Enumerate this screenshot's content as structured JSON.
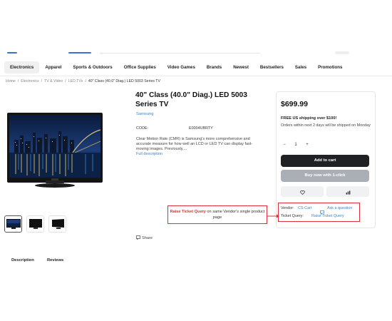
{
  "nav": {
    "categories": [
      "Electronics",
      "Apparel",
      "Sports & Outdoors",
      "Office Supplies",
      "Video Games",
      "Brands",
      "Newest",
      "Bestsellers",
      "Sales",
      "Promotions"
    ]
  },
  "breadcrumb": {
    "items": [
      "Home",
      "Electronics",
      "TV & Video",
      "LED TVs"
    ],
    "current": "40\" Class (40.0\" Diag.) LED 5003 Series TV",
    "separator": "/"
  },
  "product": {
    "title": "40\" Class (40.0\" Diag.) LED 5003 Series TV",
    "brand": "Samsung",
    "code_label": "CODE:",
    "code_value": "E0004UBRTY",
    "description": "Clear Motion Rate (CMR) is Samsung's more comprehensive and accurate measure for how well an LCD or LED TV can display fast-moving images. Previously,...",
    "full_description_link": "Full description",
    "share_label": "Share"
  },
  "buybox": {
    "price": "$699.99",
    "shipping_promo": "FREE US shipping over $100!",
    "shipping_note": "Orders within next 2 days will be shipped on Monday",
    "quantity": "1",
    "minus": "−",
    "plus": "+",
    "add_to_cart": "Add to cart",
    "buy_now": "Buy now with 1-click",
    "vendor_label": "Vendor:",
    "vendor_value": "CS-Cart",
    "ask_question": "Ask a question",
    "ticket_label": "Ticket Query:",
    "ticket_value": "Raise Ticket Query"
  },
  "callout": {
    "highlight": "Raise Ticket Query",
    "text": " on same Vendor's single product page"
  },
  "tabs": [
    "Description",
    "Reviews"
  ],
  "colors": {
    "accent_link": "#3a86c8",
    "annotation_red": "#d9323a",
    "cart_button": "#1f2124",
    "buynow_button": "#a9afb5"
  },
  "icons": {
    "heart": "heart-icon",
    "compare": "compare-icon",
    "ask": "chat-icon",
    "share": "share-icon"
  }
}
